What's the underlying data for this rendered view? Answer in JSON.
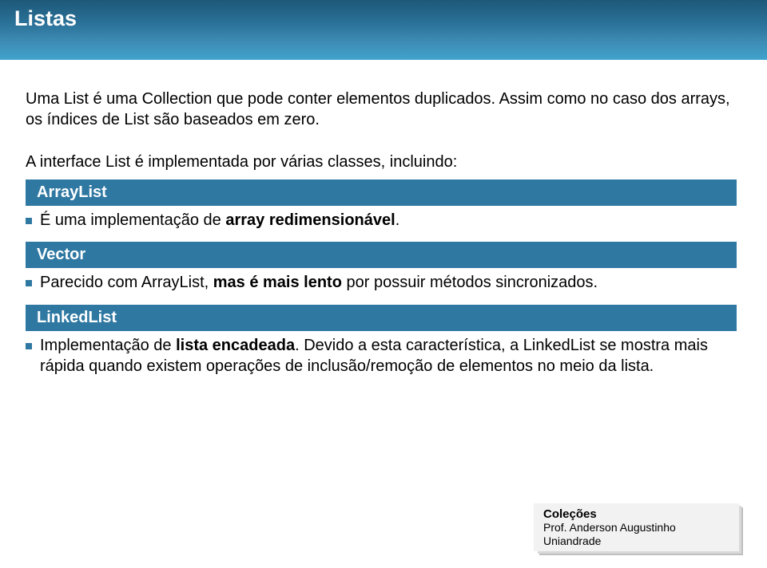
{
  "title": "Listas",
  "intro1": "Uma List é uma Collection que pode conter elementos duplicados. Assim como no caso dos arrays, os índices de List são baseados em zero.",
  "intro2": "A interface List é implementada por várias classes, incluindo:",
  "sections": {
    "arraylist": {
      "label": "ArrayList",
      "text_before": "É uma implementação de ",
      "text_bold": "array redimensionável",
      "text_after": "."
    },
    "vector": {
      "label": "Vector",
      "text_before": "Parecido com ArrayList, ",
      "text_bold": "mas é mais lento",
      "text_after": " por possuir métodos sincronizados."
    },
    "linkedlist": {
      "label": "LinkedList",
      "text_before": "Implementação de ",
      "text_bold": "lista encadeada",
      "text_after": ". Devido a esta característica, a LinkedList se mostra mais rápida quando existem operações de inclusão/remoção de elementos no meio da lista."
    }
  },
  "footer": {
    "title": "Coleções",
    "line1": "Prof. Anderson Augustinho",
    "line2": "Uniandrade"
  }
}
